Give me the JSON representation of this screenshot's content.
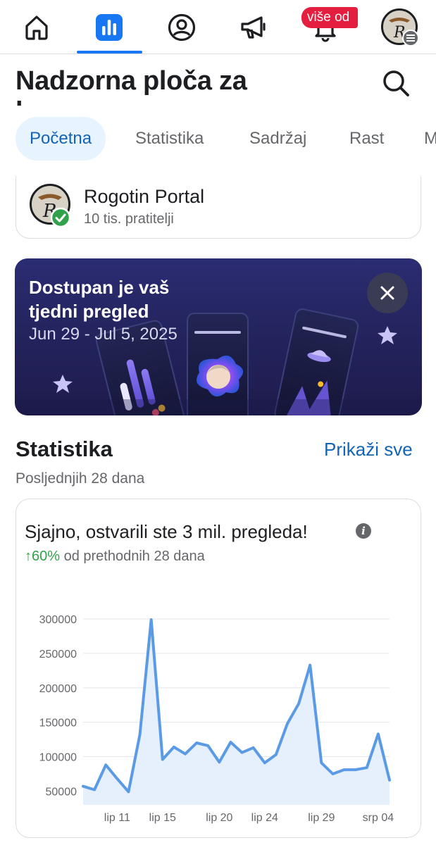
{
  "colors": {
    "accent": "#1877f2",
    "link": "#1464b4",
    "badge": "#e41e3f",
    "up": "#31a24c",
    "line": "#5b9be6",
    "area": "#e6f0fc"
  },
  "nav": {
    "items": [
      {
        "name": "home-icon"
      },
      {
        "name": "insights-icon",
        "active": true
      },
      {
        "name": "profile-icon"
      },
      {
        "name": "megaphone-icon"
      },
      {
        "name": "bell-icon"
      }
    ],
    "badge_text": "više od"
  },
  "header": {
    "title": "Nadzorna ploča za",
    "title_cut": "profesionalni rad"
  },
  "tabs": [
    {
      "label": "Početna",
      "active": true
    },
    {
      "label": "Statistika"
    },
    {
      "label": "Sadržaj"
    },
    {
      "label": "Rast"
    },
    {
      "label": "M"
    }
  ],
  "profile": {
    "name": "Rogotin Portal",
    "followers": "10 tis. pratitelji"
  },
  "promo": {
    "title": "Dostupan je vaš tjedni pregled",
    "date_range": "Jun 29 - Jul 5, 2025"
  },
  "stats": {
    "title": "Statistika",
    "show_all": "Prikaži sve",
    "subtitle": "Posljednjih 28 dana",
    "card_title": "Sjajno, ostvarili ste 3 mil. pregleda!",
    "delta_value": "↑60%",
    "delta_text": " od prethodnih 28 dana"
  },
  "chart_data": {
    "type": "area",
    "x_tick_labels": [
      "lip 11",
      "lip 15",
      "lip 20",
      "lip 24",
      "lip 29",
      "srp 04"
    ],
    "y_tick_labels": [
      "50000",
      "100000",
      "150000",
      "200000",
      "250000",
      "300000"
    ],
    "ylim": [
      30000,
      300000
    ],
    "grid": true,
    "series": [
      {
        "values": [
          57000,
          52000,
          88000,
          68000,
          49000,
          132000,
          299000,
          96000,
          114000,
          104000,
          120000,
          116000,
          92000,
          121000,
          106000,
          113000,
          91000,
          103000,
          148000,
          177000,
          233000,
          91000,
          75000,
          81000,
          81000,
          84000,
          133000,
          66000
        ]
      }
    ]
  }
}
